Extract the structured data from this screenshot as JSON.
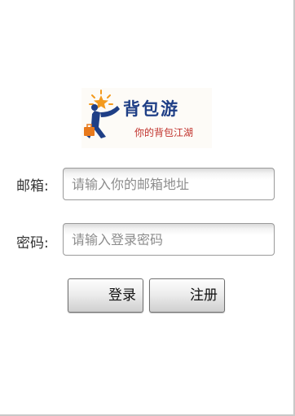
{
  "logo": {
    "name": "背包游",
    "slogan": "你的背包江湖",
    "colors": {
      "star": "#f39a1e",
      "figure": "#1f3f86",
      "bag": "#e87a1d",
      "name": "#1f3f86",
      "slogan": "#c0302a"
    }
  },
  "form": {
    "email": {
      "label": "邮箱:",
      "placeholder": "请输入你的邮箱地址",
      "value": ""
    },
    "password": {
      "label": "密码:",
      "placeholder": "请输入登录密码",
      "value": ""
    }
  },
  "buttons": {
    "login": "登录",
    "register": "注册"
  }
}
